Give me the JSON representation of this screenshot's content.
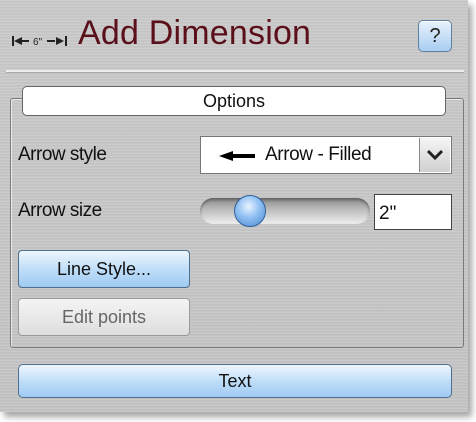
{
  "header": {
    "title": "Add Dimension",
    "help_label": "?",
    "icon": "dimension-icon",
    "title_color": "#5a0f1a"
  },
  "options": {
    "group_label": "Options",
    "arrow_style": {
      "label": "Arrow style",
      "value": "Arrow - Filled",
      "icon": "filled-arrow-icon"
    },
    "arrow_size": {
      "label": "Arrow size",
      "value": "2\"",
      "slider_level": 0.2
    },
    "line_style_button": "Line Style...",
    "edit_points_button": "Edit points"
  },
  "text_button": "Text",
  "colors": {
    "panel_bg": "#c6c6c6",
    "button_blue": "#bcdcf8",
    "slider_thumb": "#8fbff2"
  }
}
